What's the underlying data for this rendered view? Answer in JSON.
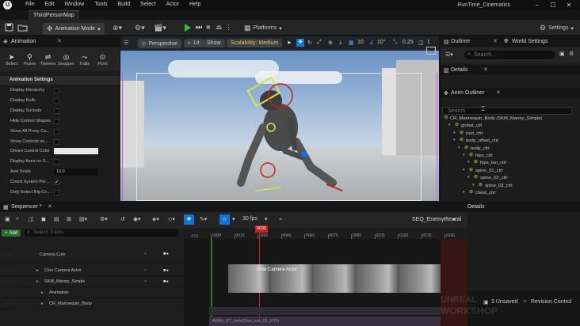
{
  "titlebar": {
    "logo": "U",
    "menus": [
      "File",
      "Edit",
      "Window",
      "Tools",
      "Build",
      "Select",
      "Actor",
      "Help"
    ],
    "project": "RunTime_Cinematics",
    "level_tab": "ThirdPersonMap"
  },
  "toolbar": {
    "mode": "Animation Mode",
    "platforms": "Platforms",
    "settings": "Settings"
  },
  "anim_panel": {
    "title": "Animation",
    "tools": [
      {
        "label": "Select",
        "icon": "cursor-icon"
      },
      {
        "label": "Poses",
        "icon": "poses-icon"
      },
      {
        "label": "Tweens",
        "icon": "tweens-icon"
      },
      {
        "label": "Snapper",
        "icon": "snapper-icon"
      },
      {
        "label": "Trails",
        "icon": "trails-icon"
      },
      {
        "label": "Pivot",
        "icon": "pivot-icon"
      }
    ],
    "settings_header": "Animation Settings",
    "settings": [
      {
        "label": "Display Hierarchy",
        "checked": false
      },
      {
        "label": "Display Nulls",
        "checked": false
      },
      {
        "label": "Display Sockets",
        "checked": false
      },
      {
        "label": "Hide Control Shapes",
        "checked": false
      },
      {
        "label": "Show All Proxy Co...",
        "checked": false
      },
      {
        "label": "Show Controls as...",
        "checked": false
      },
      {
        "label": "Driven Control Color",
        "color": "#e8e8e8"
      },
      {
        "label": "Display Axes on S...",
        "checked": false
      },
      {
        "label": "Axis Scale",
        "value": "10.0"
      },
      {
        "label": "Coord System Per...",
        "checked": true
      },
      {
        "label": "Only Select Rig Co...",
        "checked": false
      }
    ]
  },
  "viewport": {
    "perspective": "Perspective",
    "lit": "Lit",
    "show": "Show",
    "scalability": "Scalability: Medium",
    "grid_snap": "10",
    "angle_snap": "10°",
    "scale_snap": "0.25",
    "camera_speed": "1"
  },
  "outliner": {
    "title": "Outliner",
    "world_settings": "World Settings",
    "search_placeholder": "Search...",
    "details": "Details"
  },
  "anim_outliner": {
    "title": "Anim Outliner",
    "search_placeholder": "Search",
    "items": [
      {
        "label": "CR_Mannequin_Body  (SKM_Manny_Simple)",
        "depth": 0
      },
      {
        "label": "global_ctrl",
        "depth": 1
      },
      {
        "label": "root_ctrl",
        "depth": 2
      },
      {
        "label": "body_offset_ctrl",
        "depth": 2
      },
      {
        "label": "body_ctrl",
        "depth": 3
      },
      {
        "label": "hips_ctrl",
        "depth": 4
      },
      {
        "label": "hips_tan_ctrl",
        "depth": 5
      },
      {
        "label": "spine_01_ctrl",
        "depth": 4
      },
      {
        "label": "spine_02_ctrl",
        "depth": 5
      },
      {
        "label": "spine_03_ctrl",
        "depth": 6
      },
      {
        "label": "chest_ctrl",
        "depth": 4
      }
    ]
  },
  "sequencer": {
    "title": "Sequencer",
    "add": "Add",
    "search_placeholder": "Search Tracks",
    "fps": "30 fps",
    "sequence_name": "SEQ_EnemyReveal",
    "playhead_frame": "0035",
    "time_start": "-015",
    "ticks": [
      "0000",
      "0015",
      "0030",
      "0045",
      "0060",
      "0075",
      "0090",
      "0105",
      "0120",
      "0135",
      "0150"
    ],
    "tracks": [
      {
        "label": "Camera Cuts",
        "depth": 0
      },
      {
        "label": "Cine Camera Actor",
        "depth": 1
      },
      {
        "label": "SKM_Manny_Simple",
        "depth": 1
      },
      {
        "label": "Animation",
        "depth": 2
      },
      {
        "label": "CR_Mannequin_Body",
        "depth": 2
      }
    ],
    "camera_cut_label": "Cine Camera Actor",
    "anim_section_label": "ANIM_ST_heroChar_ent_05_RTG"
  },
  "right_bottom": {
    "details_tab": "Details",
    "unsaved": "3 Unsaved",
    "revision": "Revision Control"
  },
  "watermark": {
    "line1": "UNREAL",
    "line2": "WORKSHOP"
  },
  "colors": {
    "accent_blue": "#0e74d8",
    "play_green": "#2fbf3a",
    "control_yellow": "#d9e34c",
    "playhead_red": "#c32222"
  }
}
